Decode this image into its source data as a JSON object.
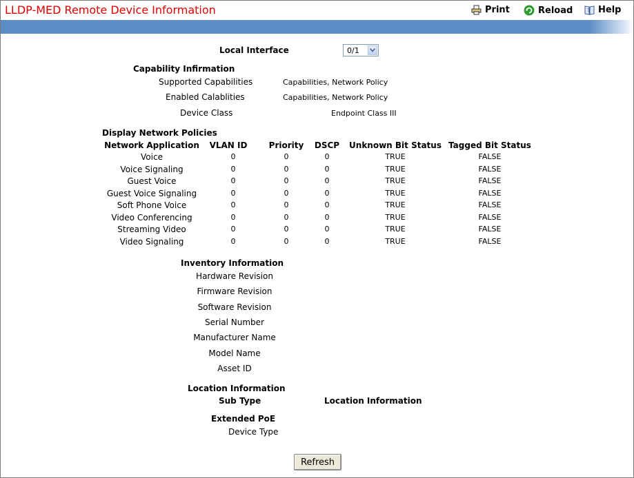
{
  "header": {
    "title": "LLDP-MED Remote Device Information",
    "print_label": "Print",
    "reload_label": "Reload",
    "help_label": "Help"
  },
  "local_interface": {
    "label": "Local Interface",
    "value": "0/1"
  },
  "capability": {
    "heading": "Capability Infirmation",
    "supported_label": "Supported Capabilities",
    "supported_value": "Capabilities, Network Policy",
    "enabled_label": "Enabled Calablities",
    "enabled_value": "Capabilities, Network Policy",
    "device_class_label": "Device Class",
    "device_class_value": "Endpoint Class III"
  },
  "policies": {
    "heading": "Display Network Policies",
    "columns": [
      "Network Application",
      "VLAN ID",
      "Priority",
      "DSCP",
      "Unknown Bit Status",
      "Tagged Bit Status"
    ],
    "rows": [
      [
        "Voice",
        "0",
        "0",
        "0",
        "TRUE",
        "FALSE"
      ],
      [
        "Voice Signaling",
        "0",
        "0",
        "0",
        "TRUE",
        "FALSE"
      ],
      [
        "Guest Voice",
        "0",
        "0",
        "0",
        "TRUE",
        "FALSE"
      ],
      [
        "Guest Voice Signaling",
        "0",
        "0",
        "0",
        "TRUE",
        "FALSE"
      ],
      [
        "Soft Phone Voice",
        "0",
        "0",
        "0",
        "TRUE",
        "FALSE"
      ],
      [
        "Video Conferencing",
        "0",
        "0",
        "0",
        "TRUE",
        "FALSE"
      ],
      [
        "Streaming Video",
        "0",
        "0",
        "0",
        "TRUE",
        "FALSE"
      ],
      [
        "Video Signaling",
        "0",
        "0",
        "0",
        "TRUE",
        "FALSE"
      ]
    ]
  },
  "inventory": {
    "heading": "Inventory Information",
    "items": [
      "Hardware Revision",
      "Firmware Revision",
      "Software Revision",
      "Serial Number",
      "Manufacturer Name",
      "Model Name",
      "Asset ID"
    ]
  },
  "location": {
    "heading": "Location Information",
    "sub_type_label": "Sub Type",
    "location_label": "Location Information"
  },
  "poe": {
    "heading": "Extended PoE",
    "device_type_label": "Device Type"
  },
  "refresh_label": "Refresh",
  "colors": {
    "title": "#e00000",
    "bar": "#5c8dc6"
  }
}
